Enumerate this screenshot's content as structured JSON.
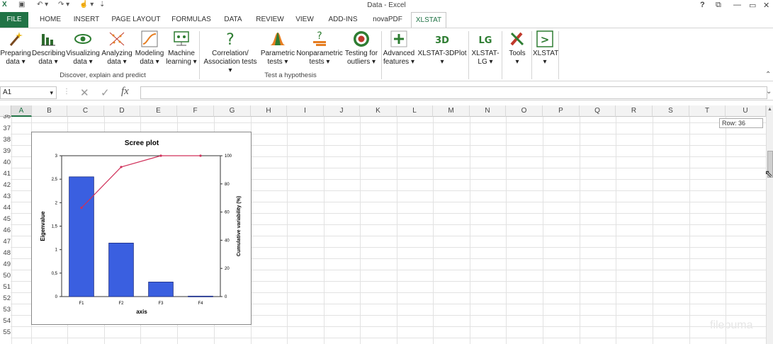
{
  "title_bar": {
    "title": "Data - Excel",
    "help": "?",
    "restore": "⧉",
    "minimize": "—",
    "maximize": "▭",
    "close": "✕"
  },
  "tabs": [
    "FILE",
    "HOME",
    "INSERT",
    "PAGE LAYOUT",
    "FORMULAS",
    "DATA",
    "REVIEW",
    "VIEW",
    "ADD-INS",
    "novaPDF",
    "XLSTAT"
  ],
  "active_tab": "XLSTAT",
  "ribbon": {
    "group1": {
      "label": "Discover, explain and predict",
      "buttons": [
        {
          "l1": "Preparing",
          "l2": "data ▾",
          "icon": "wand-icon"
        },
        {
          "l1": "Describing",
          "l2": "data ▾",
          "icon": "bar-chart-icon"
        },
        {
          "l1": "Visualizing",
          "l2": "data ▾",
          "icon": "eye-icon"
        },
        {
          "l1": "Analyzing",
          "l2": "data ▾",
          "icon": "scatter-icon"
        },
        {
          "l1": "Modeling",
          "l2": "data ▾",
          "icon": "curve-icon"
        },
        {
          "l1": "Machine",
          "l2": "learning ▾",
          "icon": "network-icon"
        }
      ]
    },
    "group2": {
      "label": "Test a hypothesis",
      "buttons": [
        {
          "l1": "Correlation/",
          "l2": "Association tests ▾",
          "icon": "question-icon"
        },
        {
          "l1": "Parametric",
          "l2": "tests ▾",
          "icon": "bell-curve-icon"
        },
        {
          "l1": "Nonparametric",
          "l2": "tests ▾",
          "icon": "question-bars-icon"
        },
        {
          "l1": "Testing for",
          "l2": "outliers ▾",
          "icon": "target-icon"
        }
      ]
    },
    "group3": [
      {
        "l1": "Advanced",
        "l2": "features ▾",
        "icon": "plus-icon"
      },
      {
        "l1": "XLSTAT-3DPlot",
        "l2": "▾",
        "icon": "3d-icon",
        "glyph": "3D"
      },
      {
        "l1": "XLSTAT-",
        "l2": "LG ▾",
        "icon": "lg-icon",
        "glyph": "LG"
      },
      {
        "l1": "Tools",
        "l2": "▾",
        "icon": "tools-icon"
      },
      {
        "l1": "XLSTAT",
        "l2": "▾",
        "icon": "xlstat-icon",
        "glyph": ">"
      }
    ]
  },
  "formula_bar": {
    "name_box": "A1",
    "name_box_arrow": "▾",
    "cancel": "✕",
    "enter": "✓",
    "fx": "fx",
    "value": ""
  },
  "columns": [
    "A",
    "B",
    "C",
    "D",
    "E",
    "F",
    "G",
    "H",
    "I",
    "J",
    "K",
    "L",
    "M",
    "N",
    "O",
    "P",
    "Q",
    "R",
    "S",
    "T",
    "U"
  ],
  "rows": [
    "36",
    "37",
    "38",
    "39",
    "40",
    "41",
    "42",
    "43",
    "44",
    "45",
    "46",
    "47",
    "48",
    "49",
    "50",
    "51",
    "52",
    "53",
    "54",
    "55"
  ],
  "tooltip": "Row: 36",
  "watermark": "filepuma",
  "chart_data": {
    "type": "bar",
    "title": "Scree plot",
    "xlabel": "axis",
    "ylabel": "Eigenvalue",
    "y2label": "Cumulative variability (%)",
    "categories": [
      "F1",
      "F2",
      "F3",
      "F4"
    ],
    "series": [
      {
        "values": [
          2.55,
          1.14,
          0.31,
          0.01
        ],
        "color": "#3a5fe0",
        "kind": "bar"
      },
      {
        "values": [
          63,
          92,
          100,
          100
        ],
        "color": "#d0305a",
        "kind": "line",
        "axis": "y2"
      }
    ],
    "ylim": [
      0,
      3
    ],
    "y2lim": [
      0,
      100
    ],
    "yticks": [
      "0",
      "0,5",
      "1",
      "1,5",
      "2",
      "2,5",
      "3"
    ],
    "y2ticks": [
      "0",
      "20",
      "40",
      "60",
      "80",
      "100"
    ]
  }
}
